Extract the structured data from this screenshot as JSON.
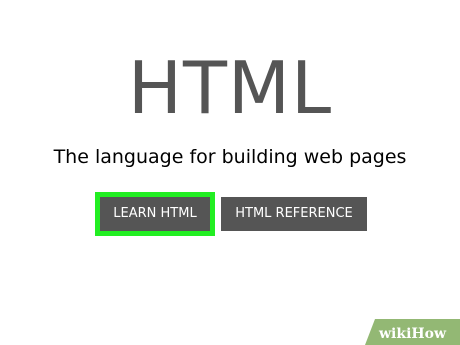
{
  "hero": {
    "title": "HTML",
    "tagline": "The language for building web pages"
  },
  "buttons": {
    "learn_label": "LEARN HTML",
    "reference_label": "HTML REFERENCE"
  },
  "highlight_color": "#22ee22",
  "watermark": {
    "text": "wikiHow"
  }
}
